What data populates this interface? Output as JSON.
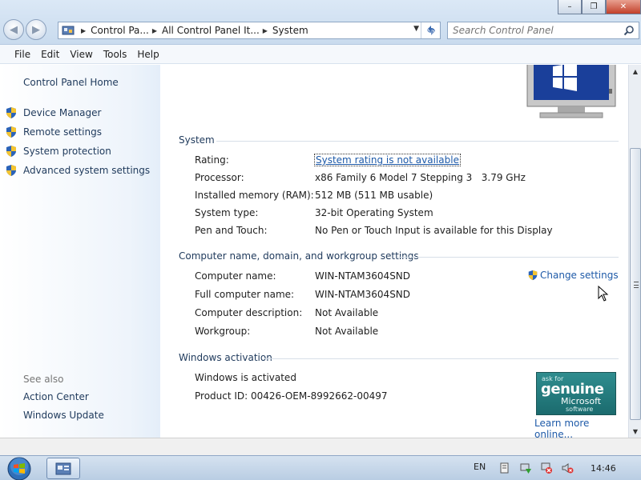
{
  "window": {
    "minimize": "–",
    "maximize": "❐",
    "close": "✕"
  },
  "address": {
    "crumbs": [
      "Control Pa...",
      "All Control Panel It...",
      "System"
    ]
  },
  "search": {
    "placeholder": "Search Control Panel"
  },
  "menu": [
    "File",
    "Edit",
    "View",
    "Tools",
    "Help"
  ],
  "leftnav": {
    "home": "Control Panel Home",
    "links": [
      "Device Manager",
      "Remote settings",
      "System protection",
      "Advanced system settings"
    ],
    "see_also": "See also",
    "see_also_links": [
      "Action Center",
      "Windows Update"
    ]
  },
  "system": {
    "title": "System",
    "rows": [
      {
        "label": "Rating:",
        "value": "System rating is not available"
      },
      {
        "label": "Processor:",
        "value": "x86 Family 6 Model 7 Stepping 3   3.79 GHz"
      },
      {
        "label": "Installed memory (RAM):",
        "value": "512 MB (511 MB usable)"
      },
      {
        "label": "System type:",
        "value": "32-bit Operating System"
      },
      {
        "label": "Pen and Touch:",
        "value": "No Pen or Touch Input is available for this Display"
      }
    ]
  },
  "computer": {
    "title": "Computer name, domain, and workgroup settings",
    "change_settings": "Change settings",
    "rows": [
      {
        "label": "Computer name:",
        "value": "WIN-NTAM3604SND"
      },
      {
        "label": "Full computer name:",
        "value": "WIN-NTAM3604SND"
      },
      {
        "label": "Computer description:",
        "value": "Not Available"
      },
      {
        "label": "Workgroup:",
        "value": "Not Available"
      }
    ]
  },
  "activation": {
    "title": "Windows activation",
    "status": "Windows is activated",
    "product_id": "Product ID: 00426-OEM-8992662-00497",
    "learn_more": "Learn more online...",
    "genuine": {
      "ask": "ask for",
      "main": "genuine",
      "brand": "Microsoft",
      "software": "software"
    }
  },
  "taskbar": {
    "language": "EN",
    "clock": "14:46"
  },
  "colors": {
    "link": "#1e5aa8",
    "nav_text": "#1e395b",
    "genuine_badge": "#2f8d8f"
  }
}
